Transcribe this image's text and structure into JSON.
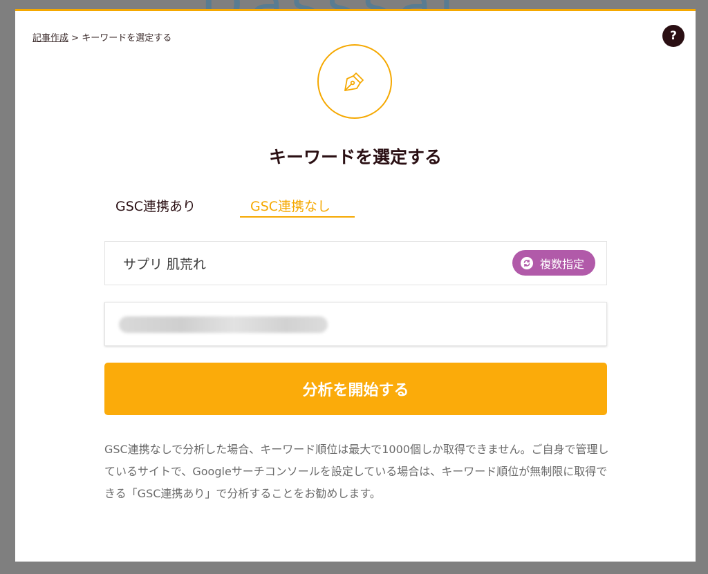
{
  "backdrop": {
    "logo_text": "Dasssal"
  },
  "breadcrumb": {
    "parent": "記事作成",
    "separator": " > ",
    "current": "キーワードを選定する"
  },
  "help": {
    "label": "?",
    "icon": "question-icon"
  },
  "header": {
    "icon": "pen-nib-icon",
    "title": "キーワードを選定する"
  },
  "tabs": [
    {
      "label": "GSC連携あり",
      "active": false
    },
    {
      "label": "GSC連携なし",
      "active": true
    }
  ],
  "keyword_field": {
    "value": "サプリ 肌荒れ",
    "multi_button_label": "複数指定",
    "multi_button_icon": "swap-icon"
  },
  "site_field": {
    "value": ""
  },
  "analyze_button": {
    "label": "分析を開始する"
  },
  "note": "GSC連携なしで分析した場合、キーワード順位は最大で1000個しか取得できません。ご自身で管理しているサイトで、Googleサーチコンソールを設定している場合は、キーワード順位が無制限に取得できる「GSC連携あり」で分析することをお勧めします。",
  "colors": {
    "accent": "#f5a800",
    "button": "#fbab0a",
    "multi_button": "#b15aa9",
    "dark_text": "#2a0f13"
  }
}
